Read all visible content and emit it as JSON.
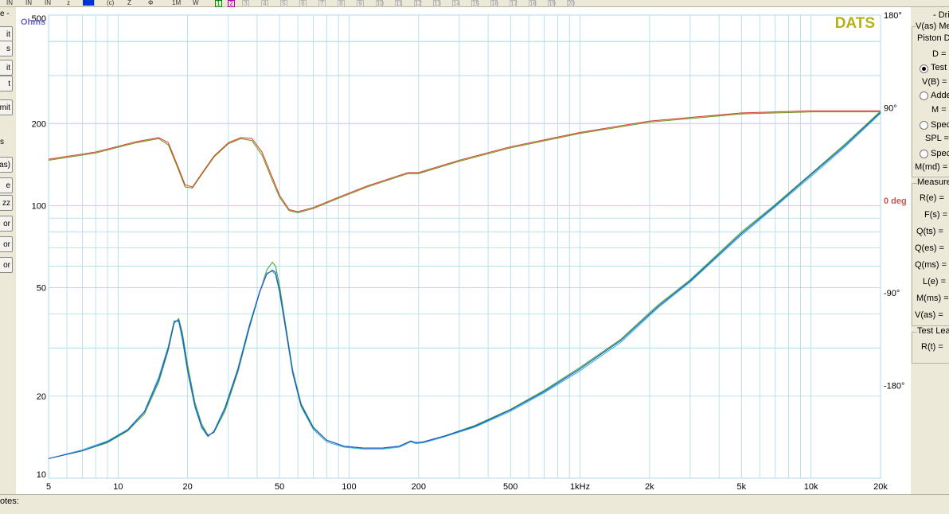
{
  "toolbar": {
    "items": [
      "IN",
      "IN",
      "IN",
      "z",
      "8",
      "(c)",
      "Z",
      "Φ",
      "1M",
      "W",
      "1",
      "2",
      "3",
      "4",
      "5",
      "6",
      "7",
      "8",
      "9",
      "10",
      "11",
      "12",
      "13",
      "14",
      "15",
      "16",
      "17",
      "18",
      "19",
      "20"
    ]
  },
  "left_panel": {
    "labels": [
      "e -",
      "it",
      "s",
      "it",
      "t",
      "mit",
      "s",
      "as)",
      "e",
      "zz",
      "or",
      "or",
      "or"
    ]
  },
  "right_panel": {
    "title": "- Dri",
    "vas_section": "V(as) Me",
    "piston": "Piston D",
    "d_label": "D =",
    "test_opt": "Test",
    "vb_label": "V(B) =",
    "added_opt": "Adde",
    "m_label": "M =",
    "spec_opt1": "Spec",
    "spl_label": "SPL =",
    "spec_opt2": "Spec",
    "mmd_label": "M(md) =",
    "measured_section": "Measure",
    "params": [
      "R(e) =",
      "F(s) =",
      "Q(ts) =",
      "Q(es) =",
      "Q(ms) =",
      "L(e) =",
      "M(ms) =",
      "V(as) ="
    ],
    "test_lead_section": "Test Lea",
    "rt_label": "R(t) ="
  },
  "status": {
    "notes_label": "otes:"
  },
  "chart_data": {
    "type": "line",
    "title": "DATS",
    "y_unit_label": "Ohms",
    "phase_unit_label": "0 deg",
    "x_scale": "log",
    "xlim": [
      5,
      20000
    ],
    "y_scale": "log",
    "ylim": [
      10,
      500
    ],
    "y2lim": [
      -270,
      180
    ],
    "x_ticks": [
      {
        "v": 5,
        "label": "5"
      },
      {
        "v": 10,
        "label": "10"
      },
      {
        "v": 20,
        "label": "20"
      },
      {
        "v": 50,
        "label": "50"
      },
      {
        "v": 100,
        "label": "100"
      },
      {
        "v": 200,
        "label": "200"
      },
      {
        "v": 500,
        "label": "500"
      },
      {
        "v": 1000,
        "label": "1kHz"
      },
      {
        "v": 2000,
        "label": "2k"
      },
      {
        "v": 5000,
        "label": "5k"
      },
      {
        "v": 10000,
        "label": "10k"
      },
      {
        "v": 20000,
        "label": "20k"
      }
    ],
    "y_ticks": [
      {
        "v": 500,
        "label": "500"
      },
      {
        "v": 200,
        "label": "200"
      },
      {
        "v": 100,
        "label": "100"
      },
      {
        "v": 50,
        "label": "50"
      },
      {
        "v": 20,
        "label": "20"
      },
      {
        "v": 10,
        "label": "10"
      }
    ],
    "y2_ticks": [
      {
        "v": 180,
        "label": "180°"
      },
      {
        "v": 90,
        "label": "90°"
      },
      {
        "v": -90,
        "label": "-90°"
      },
      {
        "v": -180,
        "label": "-180°"
      }
    ],
    "grid": true,
    "colors": {
      "impedance_1": "#2a4fcf",
      "impedance_2": "#3fae3f",
      "impedance_3": "#2fb5c8",
      "phase_1": "#d44a3a",
      "phase_2": "#7a9a2a",
      "title": "#b5b01a",
      "ohms": "#6a6acc",
      "deg": "#d45050"
    },
    "impedance_series": [
      {
        "x": [
          5,
          7,
          9,
          11,
          13,
          15,
          16.5,
          17.5,
          18.3,
          19,
          20,
          21.5,
          23,
          24.5,
          26,
          29,
          33,
          37,
          41,
          44,
          46.5,
          48,
          50,
          53,
          57,
          62,
          70,
          80,
          95,
          115,
          140,
          165,
          185,
          195,
          210,
          260,
          350,
          500,
          700,
          1000,
          1500,
          2000,
          2200,
          3000,
          5000,
          7000,
          10000,
          14000,
          20000
        ],
        "y": [
          11.8,
          12.6,
          13.6,
          15.0,
          17.5,
          23,
          30,
          37.5,
          38,
          33,
          25,
          18.5,
          15.5,
          14.3,
          14.8,
          18,
          25,
          36,
          48,
          56,
          58,
          57,
          49,
          36,
          24.5,
          18.5,
          15.3,
          13.8,
          13.1,
          12.9,
          12.9,
          13.1,
          13.7,
          13.5,
          13.6,
          14.3,
          15.5,
          17.8,
          20.8,
          25.2,
          32,
          40,
          43,
          53,
          79,
          100,
          130,
          166,
          220
        ]
      },
      {
        "x": [
          5,
          7,
          9,
          11,
          13,
          15,
          16.5,
          17.5,
          18.3,
          19,
          20,
          21.5,
          23,
          24.5,
          26,
          29,
          33,
          37,
          41,
          44,
          46.5,
          48,
          50,
          53,
          57,
          62,
          70,
          80,
          95,
          115,
          140,
          165,
          185,
          195,
          210,
          260,
          350,
          500,
          700,
          1000,
          1500,
          2000,
          2200,
          3000,
          5000,
          7000,
          10000,
          14000,
          20000
        ],
        "y": [
          11.8,
          12.6,
          13.5,
          14.9,
          17.2,
          22.5,
          29.5,
          37,
          38.5,
          34,
          26,
          19,
          15.8,
          14.4,
          14.7,
          17.6,
          24.5,
          35.5,
          48,
          58,
          62,
          60,
          51,
          37,
          25,
          18.8,
          15.4,
          13.8,
          13.1,
          12.9,
          12.9,
          13.1,
          13.7,
          13.5,
          13.6,
          14.3,
          15.6,
          17.9,
          21,
          25.5,
          32.3,
          40.5,
          43.5,
          53.5,
          80,
          101,
          131,
          168,
          222
        ]
      },
      {
        "x": [
          5,
          7,
          9,
          11,
          13,
          15,
          16.5,
          17.5,
          18.3,
          19,
          20,
          21.5,
          23,
          24.5,
          26,
          29,
          33,
          37,
          41,
          44,
          46.5,
          48,
          50,
          53,
          57,
          62,
          70,
          80,
          95,
          115,
          140,
          165,
          185,
          195,
          210,
          260,
          350,
          500,
          700,
          1000,
          1500,
          2000,
          2200,
          3000,
          5000,
          7000,
          10000,
          14000,
          20000
        ],
        "y": [
          11.8,
          12.7,
          13.7,
          15.1,
          17.6,
          23.5,
          30.5,
          37.8,
          37.5,
          32,
          24.5,
          18.2,
          15.3,
          14.2,
          14.9,
          18.2,
          25.3,
          36.5,
          48.5,
          56.5,
          57.5,
          56,
          48,
          35.5,
          24.2,
          18.3,
          15.1,
          13.6,
          13.0,
          12.8,
          12.8,
          13.0,
          13.6,
          13.4,
          13.5,
          14.2,
          15.4,
          17.6,
          20.6,
          24.8,
          31.5,
          39.5,
          42.5,
          52.5,
          78,
          99,
          128,
          164,
          218
        ]
      }
    ],
    "phase_series": [
      {
        "x": [
          5,
          8,
          12,
          15,
          16.5,
          18,
          19.5,
          21,
          23,
          26,
          30,
          34,
          38,
          42,
          46,
          50,
          55,
          60,
          70,
          90,
          120,
          180,
          200,
          300,
          500,
          1000,
          2000,
          5000,
          10000,
          20000
        ],
        "y": [
          39,
          46,
          56,
          60,
          54,
          33,
          13,
          12,
          25,
          42,
          55,
          60,
          58,
          44,
          22,
          3,
          -10,
          -12,
          -8,
          2,
          13,
          26,
          26,
          38,
          51,
          65,
          76,
          84,
          86,
          86
        ]
      },
      {
        "x": [
          5,
          8,
          12,
          15,
          16.5,
          18,
          19.5,
          21,
          23,
          26,
          30,
          34,
          38,
          42,
          46,
          50,
          55,
          60,
          70,
          90,
          120,
          180,
          200,
          300,
          500,
          1000,
          2000,
          5000,
          10000,
          20000
        ],
        "y": [
          40,
          47,
          57,
          61,
          56,
          35,
          15,
          13,
          26,
          43,
          56,
          61,
          60,
          47,
          25,
          5,
          -9,
          -11,
          -7,
          3,
          14,
          27,
          27,
          39,
          52,
          66,
          77,
          85,
          87,
          87
        ]
      }
    ]
  }
}
